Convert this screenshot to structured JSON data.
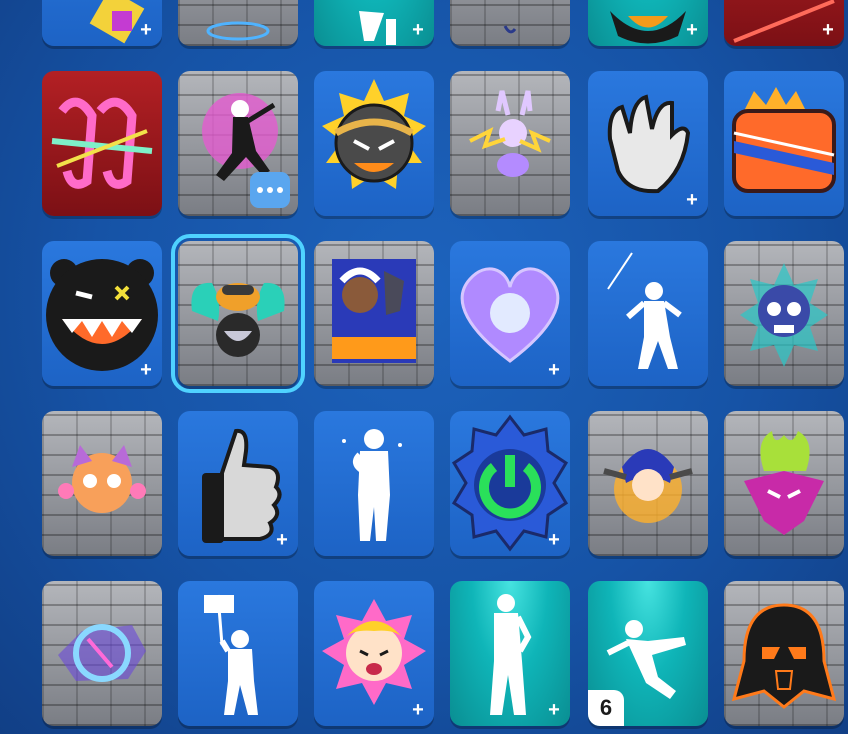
{
  "colors": {
    "background": "#1653a6",
    "tile_blue": "#2a78de",
    "tile_teal": "#0fb5b8",
    "selection_outline": "#4fd2ff"
  },
  "locker_grid": {
    "rows": [
      {
        "items": [
          {
            "kind": "spray",
            "icon": "partial-spray-icon",
            "plus": "+"
          },
          {
            "kind": "spray",
            "icon": "partial-spray-icon",
            "plus": ""
          },
          {
            "kind": "emote",
            "icon": "partial-emote-icon",
            "plus": "+"
          },
          {
            "kind": "spray",
            "icon": "partial-spray-icon",
            "plus": ""
          },
          {
            "kind": "emoticon",
            "icon": "partial-emoticon-icon",
            "plus": "+"
          },
          {
            "kind": "spray",
            "icon": "partial-red-spray-icon",
            "plus": "+"
          }
        ]
      },
      {
        "items": [
          {
            "kind": "spray",
            "icon": "gg-graffiti-icon",
            "plus": ""
          },
          {
            "kind": "spray",
            "icon": "spider-gwen-icon",
            "plus": ""
          },
          {
            "kind": "emoticon",
            "icon": "spiky-bomb-face-icon",
            "plus": ""
          },
          {
            "kind": "spray",
            "icon": "electric-bunny-icon",
            "plus": ""
          },
          {
            "kind": "emoticon",
            "icon": "claw-hand-icon",
            "plus": "+"
          },
          {
            "kind": "spray",
            "icon": "gg-crown-icon",
            "plus": ""
          }
        ]
      },
      {
        "items": [
          {
            "kind": "emoticon",
            "icon": "black-bear-grin-icon",
            "plus": "+"
          },
          {
            "kind": "spray",
            "icon": "muscle-monkey-icon",
            "plus": ""
          },
          {
            "kind": "spray",
            "icon": "faces-poster-icon",
            "plus": ""
          },
          {
            "kind": "emoticon",
            "icon": "sparkle-heart-icon",
            "plus": "+"
          },
          {
            "kind": "emote",
            "icon": "dancer-emote-icon",
            "plus": ""
          },
          {
            "kind": "spray",
            "icon": "skull-badge-icon",
            "plus": ""
          }
        ]
      },
      {
        "items": [
          {
            "kind": "spray",
            "icon": "cat-clown-icon",
            "plus": ""
          },
          {
            "kind": "emoticon",
            "icon": "thumbs-up-icon",
            "plus": "+"
          },
          {
            "kind": "emote",
            "icon": "cough-emote-icon",
            "plus": ""
          },
          {
            "kind": "emoticon",
            "icon": "power-button-icon",
            "plus": "+"
          },
          {
            "kind": "spray",
            "icon": "anime-gunner-icon",
            "plus": ""
          },
          {
            "kind": "spray",
            "icon": "flame-demon-icon",
            "plus": ""
          }
        ]
      },
      {
        "items": [
          {
            "kind": "spray",
            "icon": "neon-helmet-icon",
            "plus": ""
          },
          {
            "kind": "emote",
            "icon": "flag-wave-emote-icon",
            "plus": ""
          },
          {
            "kind": "emoticon",
            "icon": "crying-girl-icon",
            "plus": "+"
          },
          {
            "kind": "emote",
            "icon": "spotlight-dance-emote-icon",
            "plus": "+"
          },
          {
            "kind": "emote",
            "icon": "spotlight-kick-emote-icon",
            "plus": ""
          },
          {
            "kind": "spray",
            "icon": "darth-vader-icon",
            "plus": ""
          }
        ]
      }
    ],
    "selected_item": "muscle-monkey-icon",
    "more_options_label": "•••",
    "quantity_badge": "6"
  }
}
